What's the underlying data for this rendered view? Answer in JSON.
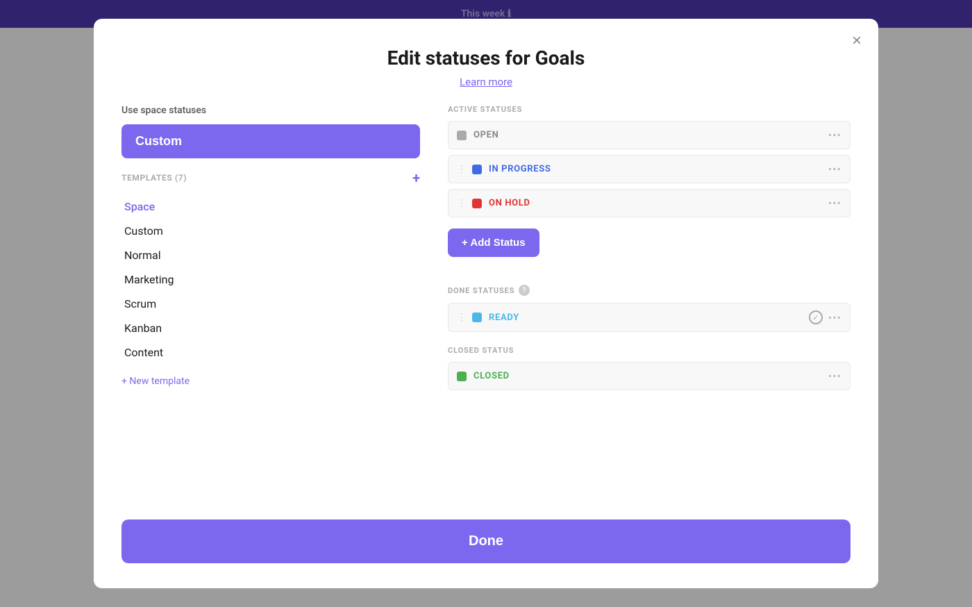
{
  "app": {
    "topbar_label": "This week",
    "info_icon": "ℹ"
  },
  "modal": {
    "title": "Edit statuses for Goals",
    "learn_more": "Learn more",
    "close_label": "×",
    "use_space_label": "Use space statuses",
    "selected_template": "Custom",
    "templates_header": "TEMPLATES (7)",
    "templates_add_icon": "+",
    "templates": [
      {
        "label": "Space",
        "style": "space"
      },
      {
        "label": "Custom",
        "style": "normal"
      },
      {
        "label": "Normal",
        "style": "normal"
      },
      {
        "label": "Marketing",
        "style": "normal"
      },
      {
        "label": "Scrum",
        "style": "normal"
      },
      {
        "label": "Kanban",
        "style": "normal"
      },
      {
        "label": "Content",
        "style": "normal"
      }
    ],
    "new_template_label": "+ New template",
    "active_statuses_label": "ACTIVE STATUSES",
    "active_statuses": [
      {
        "name": "OPEN",
        "color_class": "gray",
        "text_class": "gray-text",
        "drag": false
      },
      {
        "name": "IN PROGRESS",
        "color_class": "blue-dark",
        "text_class": "blue-dark-text",
        "drag": true
      },
      {
        "name": "ON HOLD",
        "color_class": "red",
        "text_class": "red-text",
        "drag": true
      }
    ],
    "add_status_label": "+ Add Status",
    "done_statuses_label": "DONE STATUSES",
    "done_statuses": [
      {
        "name": "READY",
        "color_class": "blue",
        "text_class": "blue-text",
        "has_check": true
      }
    ],
    "closed_status_label": "CLOSED STATUS",
    "closed_statuses": [
      {
        "name": "CLOSED",
        "color_class": "green",
        "text_class": "green-text",
        "has_check": false
      }
    ],
    "done_button_label": "Done"
  }
}
